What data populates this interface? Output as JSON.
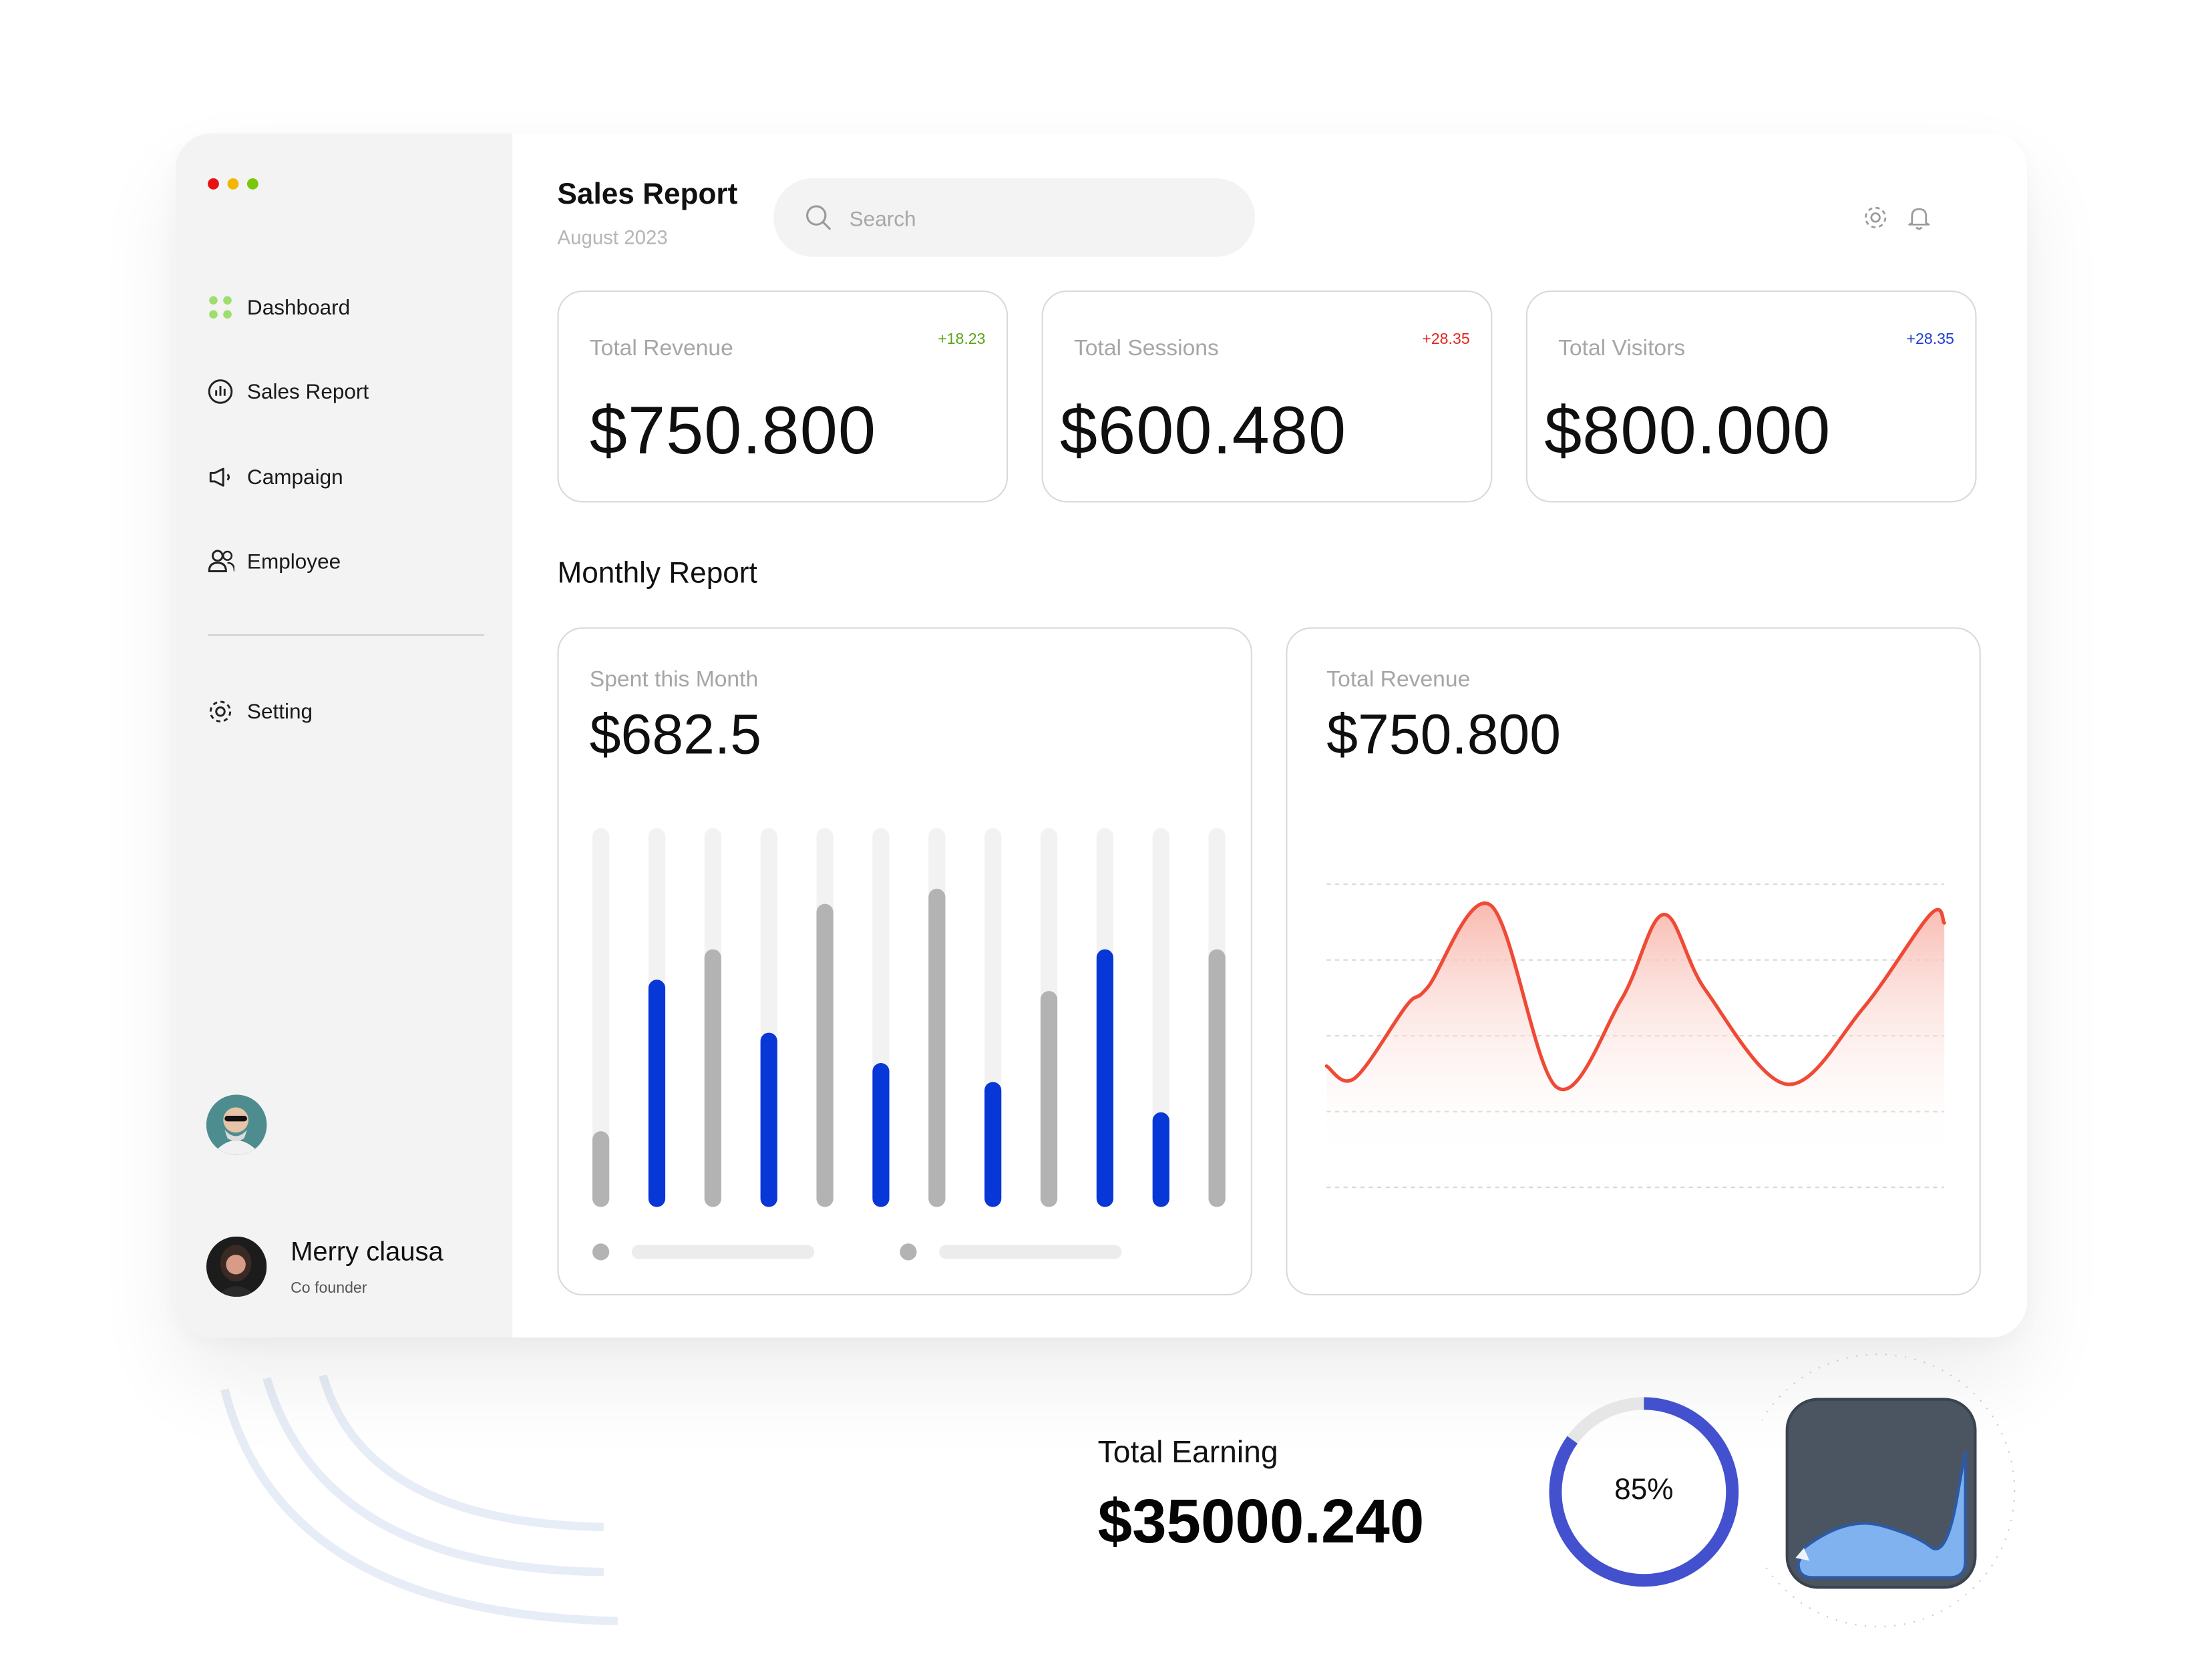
{
  "window": {
    "controls": [
      "#e8110f",
      "#f2b705",
      "#7ac70c"
    ]
  },
  "sidebar": {
    "items": [
      {
        "label": "Dashboard",
        "icon": "dashboard-grid-icon"
      },
      {
        "label": "Sales Report",
        "icon": "chart-circle-icon"
      },
      {
        "label": "Campaign",
        "icon": "megaphone-icon"
      },
      {
        "label": "Employee",
        "icon": "users-icon"
      }
    ],
    "settings": {
      "label": "Setting",
      "icon": "gear-icon"
    },
    "profile": {
      "name": "Merry clausa",
      "role": "Co founder"
    }
  },
  "header": {
    "title": "Sales Report",
    "subtitle": "August 2023",
    "search_placeholder": "Search",
    "icons": [
      "gear-icon",
      "bell-icon"
    ]
  },
  "stats": [
    {
      "label": "Total Revenue",
      "change": "+18.23",
      "change_color": "#5aa516",
      "value": "$750.800"
    },
    {
      "label": "Total Sessions",
      "change": "+28.35",
      "change_color": "#e0261b",
      "value": "$600.480"
    },
    {
      "label": "Total Visitors",
      "change": "+28.35",
      "change_color": "#1c3fcf",
      "value": "$800.000"
    }
  ],
  "monthly": {
    "title": "Monthly Report",
    "spent": {
      "label": "Spent this Month",
      "value": "$682.5"
    },
    "revenue": {
      "label": "Total Revenue",
      "value": "$750.800"
    }
  },
  "chart_data": [
    {
      "type": "bar",
      "title": "Spent this Month",
      "series": [
        {
          "values": [
            0.2,
            0.6,
            0.68,
            0.46,
            0.8,
            0.38,
            0.84,
            0.33,
            0.57,
            0.68,
            0.25,
            0.68
          ]
        }
      ],
      "colors": [
        "#b3b3b3",
        "#0737d6",
        "#b3b3b3",
        "#0737d6",
        "#b3b3b3",
        "#0737d6",
        "#b3b3b3",
        "#0737d6",
        "#b3b3b3",
        "#0737d6",
        "#0737d6",
        "#b3b3b3"
      ],
      "track_color": "#f2f2f2",
      "ylim": [
        0,
        1
      ],
      "legend": "bottom"
    },
    {
      "type": "area",
      "title": "Total Revenue",
      "series": [
        {
          "values": [
            0.4,
            0.36,
            0.6,
            0.66,
            0.93,
            0.33,
            0.62,
            0.9,
            0.65,
            0.34,
            0.59,
            0.9
          ]
        }
      ],
      "color": "#ef4a35",
      "fill_top": "#f8b6ac",
      "ylim": [
        0,
        1
      ],
      "grid": true
    }
  ],
  "earning": {
    "label": "Total Earning",
    "value": "$35000.240",
    "percent": 85,
    "percent_label": "85%",
    "ring_color": "#4351cf"
  }
}
